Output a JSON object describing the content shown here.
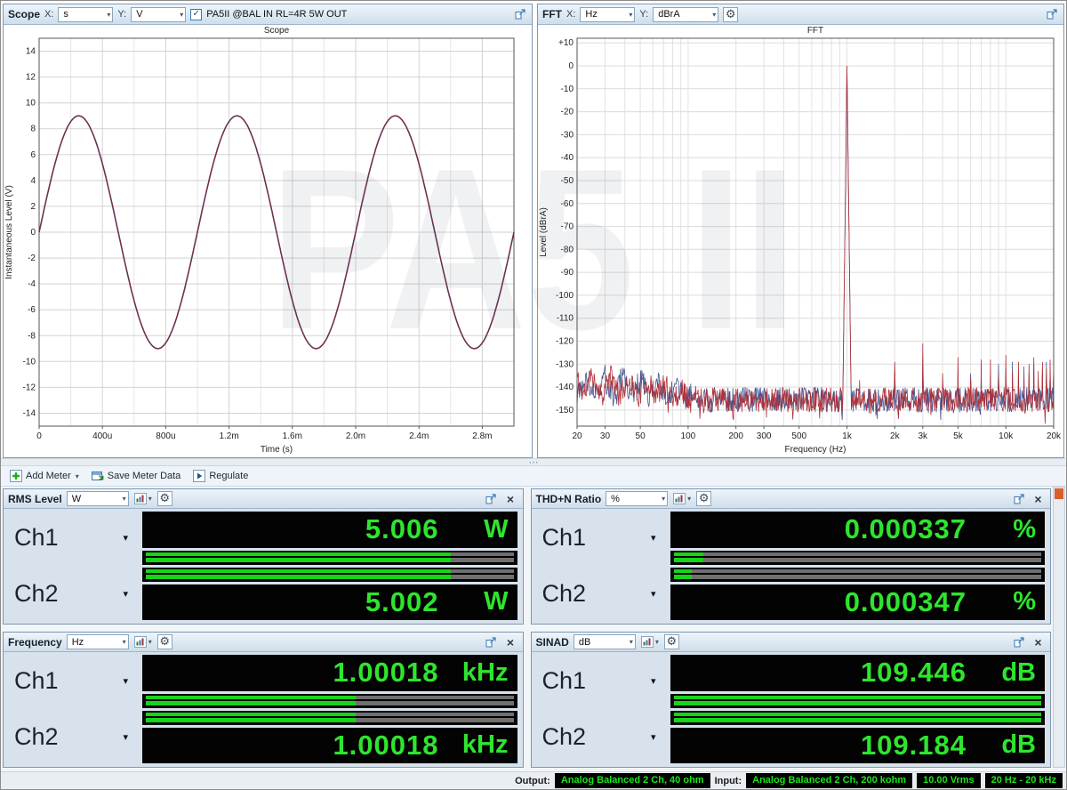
{
  "watermark": "PA5 II",
  "scope_panel": {
    "title": "Scope",
    "x_label": "X:",
    "x_unit": "s",
    "y_label": "Y:",
    "y_unit": "V",
    "annotation": "PA5II @BAL IN RL=4R 5W OUT",
    "annotation_checked": true
  },
  "fft_panel": {
    "title": "FFT",
    "x_label": "X:",
    "x_unit": "Hz",
    "y_label": "Y:",
    "y_unit": "dBrA"
  },
  "toolbar": {
    "add_meter": "Add Meter",
    "save_meter_data": "Save Meter Data",
    "regulate": "Regulate"
  },
  "statusbar": {
    "output_label": "Output:",
    "output_value": "Analog Balanced 2 Ch, 40 ohm",
    "input_label": "Input:",
    "input_value": "Analog Balanced 2 Ch, 200 kohm",
    "input_level": "10.00 Vrms",
    "input_bandwidth": "20 Hz - 20 kHz"
  },
  "meters": [
    {
      "title": "RMS Level",
      "unit": "W",
      "channels": [
        {
          "name": "Ch1",
          "value": "5.006",
          "unit": "W",
          "bar": 0.83
        },
        {
          "name": "Ch2",
          "value": "5.002",
          "unit": "W",
          "bar": 0.83
        }
      ]
    },
    {
      "title": "THD+N Ratio",
      "unit": "%",
      "channels": [
        {
          "name": "Ch1",
          "value": "0.000337",
          "unit": "%",
          "bar": 0.08
        },
        {
          "name": "Ch2",
          "value": "0.000347",
          "unit": "%",
          "bar": 0.05
        }
      ]
    },
    {
      "title": "Frequency",
      "unit": "Hz",
      "channels": [
        {
          "name": "Ch1",
          "value": "1.00018",
          "unit": "kHz",
          "bar": 0.57
        },
        {
          "name": "Ch2",
          "value": "1.00018",
          "unit": "kHz",
          "bar": 0.57
        }
      ]
    },
    {
      "title": "SINAD",
      "unit": "dB",
      "channels": [
        {
          "name": "Ch1",
          "value": "109.446",
          "unit": "dB",
          "bar": 1.0
        },
        {
          "name": "Ch2",
          "value": "109.184",
          "unit": "dB",
          "bar": 1.0
        }
      ]
    }
  ],
  "chart_data": [
    {
      "type": "line",
      "id": "scope",
      "title": "Scope",
      "xlabel": "Time (s)",
      "ylabel": "Instantaneous Level (V)",
      "xlim": [
        0,
        0.003
      ],
      "ylim": [
        -15,
        15
      ],
      "grid": true,
      "x_ticks": [
        {
          "v": 0,
          "label": "0"
        },
        {
          "v": 0.0004,
          "label": "400u"
        },
        {
          "v": 0.0008,
          "label": "800u"
        },
        {
          "v": 0.0012,
          "label": "1.2m"
        },
        {
          "v": 0.0016,
          "label": "1.6m"
        },
        {
          "v": 0.002,
          "label": "2.0m"
        },
        {
          "v": 0.0024,
          "label": "2.4m"
        },
        {
          "v": 0.0028,
          "label": "2.8m"
        }
      ],
      "y_ticks_min": -14,
      "y_ticks_max": 14,
      "y_tick_step": 2,
      "signal": {
        "shape": "sine",
        "amplitude_v": 9,
        "frequency_hz": 1000,
        "cycles_shown": 3
      },
      "series": [
        {
          "name": "Ch1",
          "color": "#8a2433"
        },
        {
          "name": "Ch2",
          "color": "#41508c"
        }
      ]
    },
    {
      "type": "line",
      "id": "fft",
      "title": "FFT",
      "xlabel": "Frequency (Hz)",
      "ylabel": "Level (dBrA)",
      "xscale": "log",
      "xlim": [
        20,
        20000
      ],
      "ylim": [
        -157,
        12
      ],
      "grid": true,
      "x_ticks": [
        {
          "v": 20,
          "label": "20"
        },
        {
          "v": 30,
          "label": "30"
        },
        {
          "v": 50,
          "label": "50"
        },
        {
          "v": 100,
          "label": "100"
        },
        {
          "v": 200,
          "label": "200"
        },
        {
          "v": 300,
          "label": "300"
        },
        {
          "v": 500,
          "label": "500"
        },
        {
          "v": 1000,
          "label": "1k"
        },
        {
          "v": 2000,
          "label": "2k"
        },
        {
          "v": 3000,
          "label": "3k"
        },
        {
          "v": 5000,
          "label": "5k"
        },
        {
          "v": 10000,
          "label": "10k"
        },
        {
          "v": 20000,
          "label": "20k"
        }
      ],
      "y_ticks": [
        {
          "v": 10,
          "label": "+10"
        },
        {
          "v": 0,
          "label": "0"
        },
        {
          "v": -10,
          "label": "-10"
        },
        {
          "v": -20,
          "label": "-20"
        },
        {
          "v": -30,
          "label": "-30"
        },
        {
          "v": -40,
          "label": "-40"
        },
        {
          "v": -50,
          "label": "-50"
        },
        {
          "v": -60,
          "label": "-60"
        },
        {
          "v": -70,
          "label": "-70"
        },
        {
          "v": -80,
          "label": "-80"
        },
        {
          "v": -90,
          "label": "-90"
        },
        {
          "v": -100,
          "label": "-100"
        },
        {
          "v": -110,
          "label": "-110"
        },
        {
          "v": -120,
          "label": "-120"
        },
        {
          "v": -130,
          "label": "-130"
        },
        {
          "v": -140,
          "label": "-140"
        },
        {
          "v": -150,
          "label": "-150"
        }
      ],
      "fundamental": {
        "freq_hz": 1000,
        "level_db": 0
      },
      "noise_floor_db": -146,
      "series": [
        {
          "name": "Ch1",
          "color": "#b03038",
          "harmonics": [
            [
              1200,
              -137
            ],
            [
              2000,
              -129
            ],
            [
              3000,
              -121
            ],
            [
              4000,
              -134
            ],
            [
              5000,
              -127
            ],
            [
              6000,
              -136
            ],
            [
              7000,
              -130
            ],
            [
              8000,
              -128
            ],
            [
              9000,
              -135
            ],
            [
              10000,
              -126
            ],
            [
              11000,
              -133
            ],
            [
              12000,
              -129
            ],
            [
              13000,
              -136
            ],
            [
              14000,
              -130
            ],
            [
              15000,
              -127
            ],
            [
              16000,
              -133
            ],
            [
              17000,
              -129
            ],
            [
              18000,
              -132
            ],
            [
              19000,
              -128
            ],
            [
              20000,
              -130
            ]
          ]
        },
        {
          "name": "Ch2",
          "color": "#44548f",
          "harmonics": [
            [
              2000,
              -133
            ],
            [
              3000,
              -127
            ],
            [
              4000,
              -138
            ],
            [
              5000,
              -131
            ],
            [
              6000,
              -134
            ],
            [
              7000,
              -128
            ],
            [
              8000,
              -135
            ],
            [
              9000,
              -130
            ],
            [
              10000,
              -132
            ],
            [
              11000,
              -129
            ],
            [
              12000,
              -136
            ],
            [
              13000,
              -131
            ],
            [
              14000,
              -134
            ],
            [
              15000,
              -130
            ],
            [
              16000,
              -137
            ],
            [
              17000,
              -132
            ],
            [
              18000,
              -129
            ],
            [
              19000,
              -134
            ],
            [
              20000,
              -133
            ]
          ]
        }
      ]
    }
  ]
}
